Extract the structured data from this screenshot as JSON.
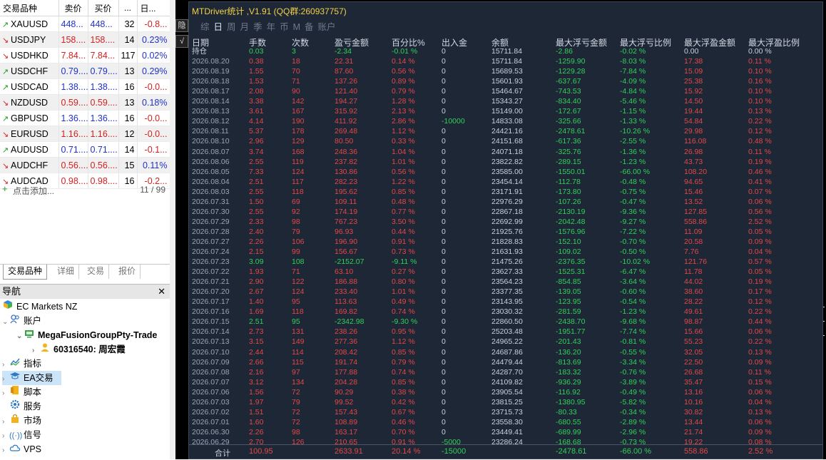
{
  "market_watch": {
    "headers": [
      "交易品种",
      "卖价",
      "买价",
      "...",
      "日..."
    ],
    "rows": [
      {
        "dir": "up",
        "symbol": "XAUUSD",
        "bid": "448...",
        "ask": "448...",
        "spread": "32",
        "change": "-0.8...",
        "change_color": "red"
      },
      {
        "dir": "dn",
        "symbol": "USDJPY",
        "bid": "158....",
        "ask": "158....",
        "spread": "14",
        "change": "0.23%",
        "change_color": "blue"
      },
      {
        "dir": "dn",
        "symbol": "USDHKD",
        "bid": "7.84...",
        "ask": "7.84...",
        "spread": "117",
        "change": "0.02%",
        "change_color": "blue"
      },
      {
        "dir": "up",
        "symbol": "USDCHF",
        "bid": "0.79....",
        "ask": "0.79....",
        "spread": "13",
        "change": "0.29%",
        "change_color": "blue"
      },
      {
        "dir": "up",
        "symbol": "USDCAD",
        "bid": "1.38....",
        "ask": "1.38....",
        "spread": "16",
        "change": "-0.0...",
        "change_color": "red"
      },
      {
        "dir": "dn",
        "symbol": "NZDUSD",
        "bid": "0.59....",
        "ask": "0.59....",
        "spread": "13",
        "change": "0.18%",
        "change_color": "blue"
      },
      {
        "dir": "up",
        "symbol": "GBPUSD",
        "bid": "1.36....",
        "ask": "1.36....",
        "spread": "16",
        "change": "-0.0...",
        "change_color": "red"
      },
      {
        "dir": "dn",
        "symbol": "EURUSD",
        "bid": "1.16....",
        "ask": "1.16....",
        "spread": "12",
        "change": "-0.0...",
        "change_color": "red"
      },
      {
        "dir": "up",
        "symbol": "AUDUSD",
        "bid": "0.71....",
        "ask": "0.71....",
        "spread": "14",
        "change": "-0.1...",
        "change_color": "red"
      },
      {
        "dir": "dn",
        "symbol": "AUDCHF",
        "bid": "0.56....",
        "ask": "0.56....",
        "spread": "15",
        "change": "0.11%",
        "change_color": "blue"
      },
      {
        "dir": "dn",
        "symbol": "AUDCAD",
        "bid": "0.98....",
        "ask": "0.98....",
        "spread": "16",
        "change": "-0.2...",
        "change_color": "red"
      }
    ],
    "add_label": "点击添加...",
    "count": "11 / 99",
    "tabs": [
      "交易品种",
      "详细",
      "交易",
      "报价"
    ]
  },
  "navigator": {
    "title": "导航",
    "broker": "EC Markets NZ",
    "accounts": "账户",
    "server": "MegaFusionGroupPty-Trade",
    "account": "60316540: 周宏霞",
    "indicators": "指标",
    "ea": "EA交易",
    "scripts": "脚本",
    "services": "服务",
    "market": "市场",
    "signals": "信号",
    "vps": "VPS"
  },
  "panel": {
    "title": "MTDriver统计 ,V1.91 (QQ群:260937757)",
    "tabs": [
      "综",
      "日",
      "周",
      "月",
      "季",
      "年",
      "币",
      "M",
      "备",
      "账户"
    ],
    "active_tab": 1,
    "side_buttons": [
      "隐",
      "√"
    ],
    "columns": [
      "日期",
      "手数",
      "次数",
      "盈亏金额",
      "百分比%",
      "出入金",
      "余额",
      "最大浮亏金额",
      "最大浮亏比例",
      "最大浮盈金额",
      "最大浮盈比例"
    ],
    "holding": [
      "持仓",
      "0.03",
      "3",
      "-2.34",
      "-0.01 %",
      "0",
      "15711.84",
      "-2.86",
      "-0.02 %",
      "0.00",
      "0.00 %"
    ],
    "rows": [
      [
        "2026.08.20",
        "0.38",
        "18",
        "22.31",
        "0.14 %",
        "0",
        "15711.84",
        "-1259.90",
        "-8.03 %",
        "17.38",
        "0.11 %"
      ],
      [
        "2026.08.19",
        "1.55",
        "70",
        "87.60",
        "0.56 %",
        "0",
        "15689.53",
        "-1229.28",
        "-7.84 %",
        "15.09",
        "0.10 %"
      ],
      [
        "2026.08.18",
        "1.53",
        "71",
        "137.26",
        "0.89 %",
        "0",
        "15601.93",
        "-637.67",
        "-4.09 %",
        "25.38",
        "0.16 %"
      ],
      [
        "2026.08.17",
        "2.08",
        "90",
        "121.40",
        "0.79 %",
        "0",
        "15464.67",
        "-743.53",
        "-4.84 %",
        "15.92",
        "0.10 %"
      ],
      [
        "2026.08.14",
        "3.38",
        "142",
        "194.27",
        "1.28 %",
        "0",
        "15343.27",
        "-834.40",
        "-5.46 %",
        "14.50",
        "0.10 %"
      ],
      [
        "2026.08.13",
        "3.61",
        "167",
        "315.92",
        "2.13 %",
        "0",
        "15149.00",
        "-172.67",
        "-1.15 %",
        "19.44",
        "0.13 %"
      ],
      [
        "2026.08.12",
        "4.14",
        "190",
        "411.92",
        "2.86 %",
        "-10000",
        "14833.08",
        "-325.66",
        "-1.33 %",
        "54.84",
        "0.22 %"
      ],
      [
        "2026.08.11",
        "5.37",
        "178",
        "269.48",
        "1.12 %",
        "0",
        "24421.16",
        "-2478.61",
        "-10.26 %",
        "29.98",
        "0.12 %"
      ],
      [
        "2026.08.10",
        "2.96",
        "129",
        "80.50",
        "0.33 %",
        "0",
        "24151.68",
        "-617.36",
        "-2.55 %",
        "116.08",
        "0.48 %"
      ],
      [
        "2026.08.07",
        "3.74",
        "168",
        "248.36",
        "1.04 %",
        "0",
        "24071.18",
        "-325.76",
        "-1.36 %",
        "26.98",
        "0.11 %"
      ],
      [
        "2026.08.06",
        "2.55",
        "119",
        "237.82",
        "1.01 %",
        "0",
        "23822.82",
        "-289.15",
        "-1.23 %",
        "43.73",
        "0.19 %"
      ],
      [
        "2026.08.05",
        "7.33",
        "124",
        "130.86",
        "0.56 %",
        "0",
        "23585.00",
        "-1550.01",
        "-66.00 %",
        "108.20",
        "0.46 %"
      ],
      [
        "2026.08.04",
        "2.51",
        "117",
        "282.23",
        "1.22 %",
        "0",
        "23454.14",
        "-112.78",
        "-0.48 %",
        "94.65",
        "0.41 %"
      ],
      [
        "2026.08.03",
        "2.55",
        "118",
        "195.62",
        "0.85 %",
        "0",
        "23171.91",
        "-173.80",
        "-0.75 %",
        "15.46",
        "0.07 %"
      ],
      [
        "2026.07.31",
        "1.50",
        "69",
        "109.11",
        "0.48 %",
        "0",
        "22976.29",
        "-107.26",
        "-0.47 %",
        "13.52",
        "0.06 %"
      ],
      [
        "2026.07.30",
        "2.55",
        "92",
        "174.19",
        "0.77 %",
        "0",
        "22867.18",
        "-2130.19",
        "-9.36 %",
        "127.85",
        "0.56 %"
      ],
      [
        "2026.07.29",
        "2.33",
        "98",
        "767.23",
        "3.50 %",
        "0",
        "22692.99",
        "-2042.48",
        "-9.27 %",
        "558.86",
        "2.52 %"
      ],
      [
        "2026.07.28",
        "2.40",
        "79",
        "96.93",
        "0.44 %",
        "0",
        "21925.76",
        "-1576.96",
        "-7.22 %",
        "11.09",
        "0.05 %"
      ],
      [
        "2026.07.27",
        "2.26",
        "106",
        "196.90",
        "0.91 %",
        "0",
        "21828.83",
        "-152.10",
        "-0.70 %",
        "20.58",
        "0.09 %"
      ],
      [
        "2026.07.24",
        "2.15",
        "99",
        "156.67",
        "0.73 %",
        "0",
        "21631.93",
        "-109.02",
        "-0.50 %",
        "7.76",
        "0.04 %"
      ],
      [
        "2026.07.23",
        "3.09",
        "108",
        "-2152.07",
        "-9.11 %",
        "0",
        "21475.26",
        "-2376.35",
        "-10.02 %",
        "121.76",
        "0.57 %"
      ],
      [
        "2026.07.22",
        "1.93",
        "71",
        "63.10",
        "0.27 %",
        "0",
        "23627.33",
        "-1525.31",
        "-6.47 %",
        "11.78",
        "0.05 %"
      ],
      [
        "2026.07.21",
        "2.90",
        "122",
        "186.88",
        "0.80 %",
        "0",
        "23564.23",
        "-854.85",
        "-3.64 %",
        "44.02",
        "0.19 %"
      ],
      [
        "2026.07.20",
        "2.67",
        "124",
        "233.40",
        "1.01 %",
        "0",
        "23377.35",
        "-139.05",
        "-0.60 %",
        "38.60",
        "0.17 %"
      ],
      [
        "2026.07.17",
        "1.40",
        "95",
        "113.63",
        "0.49 %",
        "0",
        "23143.95",
        "-123.95",
        "-0.54 %",
        "28.22",
        "0.12 %"
      ],
      [
        "2026.07.16",
        "1.69",
        "118",
        "169.82",
        "0.74 %",
        "0",
        "23030.32",
        "-281.59",
        "-1.23 %",
        "49.61",
        "0.22 %"
      ],
      [
        "2026.07.15",
        "2.51",
        "95",
        "-2342.98",
        "-9.30 %",
        "0",
        "22860.50",
        "-2438.70",
        "-9.68 %",
        "98.87",
        "0.44 %"
      ],
      [
        "2026.07.14",
        "2.73",
        "131",
        "238.26",
        "0.95 %",
        "0",
        "25203.48",
        "-1951.77",
        "-7.74 %",
        "15.66",
        "0.06 %"
      ],
      [
        "2026.07.13",
        "3.15",
        "149",
        "277.36",
        "1.12 %",
        "0",
        "24965.22",
        "-201.43",
        "-0.81 %",
        "55.23",
        "0.22 %"
      ],
      [
        "2026.07.10",
        "2.44",
        "114",
        "208.42",
        "0.85 %",
        "0",
        "24687.86",
        "-136.20",
        "-0.55 %",
        "32.05",
        "0.13 %"
      ],
      [
        "2026.07.09",
        "2.66",
        "115",
        "191.74",
        "0.79 %",
        "0",
        "24479.44",
        "-813.69",
        "-3.34 %",
        "22.50",
        "0.09 %"
      ],
      [
        "2026.07.08",
        "2.16",
        "97",
        "177.88",
        "0.74 %",
        "0",
        "24287.70",
        "-183.32",
        "-0.76 %",
        "26.68",
        "0.11 %"
      ],
      [
        "2026.07.07",
        "3.12",
        "134",
        "204.28",
        "0.85 %",
        "0",
        "24109.82",
        "-936.29",
        "-3.89 %",
        "35.47",
        "0.15 %"
      ],
      [
        "2026.07.06",
        "1.56",
        "72",
        "90.29",
        "0.38 %",
        "0",
        "23905.54",
        "-116.92",
        "-0.49 %",
        "13.16",
        "0.06 %"
      ],
      [
        "2026.07.03",
        "1.97",
        "79",
        "99.52",
        "0.42 %",
        "0",
        "23815.25",
        "-1380.95",
        "-5.82 %",
        "10.16",
        "0.04 %"
      ],
      [
        "2026.07.02",
        "1.51",
        "72",
        "157.43",
        "0.67 %",
        "0",
        "23715.73",
        "-80.33",
        "-0.34 %",
        "30.82",
        "0.13 %"
      ],
      [
        "2026.07.01",
        "1.60",
        "72",
        "108.89",
        "0.46 %",
        "0",
        "23558.30",
        "-680.55",
        "-2.89 %",
        "13.44",
        "0.06 %"
      ],
      [
        "2026.06.30",
        "2.26",
        "98",
        "163.17",
        "0.70 %",
        "0",
        "23449.41",
        "-689.99",
        "-2.96 %",
        "21.74",
        "0.09 %"
      ],
      [
        "2026.06.29",
        "2.70",
        "126",
        "210.65",
        "0.91 %",
        "-5000",
        "23286.24",
        "-168.68",
        "-0.73 %",
        "19.22",
        "0.08 %"
      ]
    ],
    "totals": [
      "合计",
      "100.95",
      "",
      "2633.91",
      "20.14 %",
      "-15000",
      "",
      "-2478.61",
      "-66.00 %",
      "558.86",
      "2.52 %"
    ]
  }
}
